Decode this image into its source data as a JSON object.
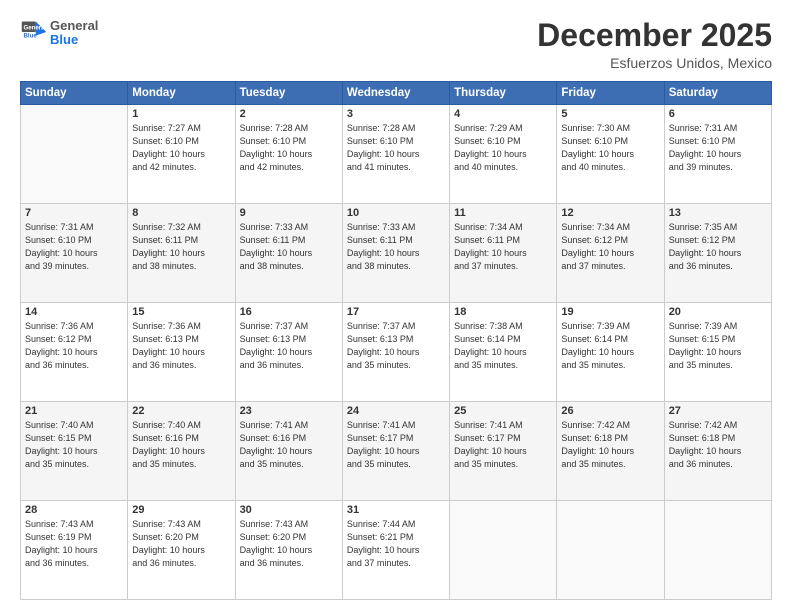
{
  "logo": {
    "general": "General",
    "blue": "Blue"
  },
  "header": {
    "month": "December 2025",
    "location": "Esfuerzos Unidos, Mexico"
  },
  "days_of_week": [
    "Sunday",
    "Monday",
    "Tuesday",
    "Wednesday",
    "Thursday",
    "Friday",
    "Saturday"
  ],
  "weeks": [
    [
      {
        "day": "",
        "info": ""
      },
      {
        "day": "1",
        "info": "Sunrise: 7:27 AM\nSunset: 6:10 PM\nDaylight: 10 hours\nand 42 minutes."
      },
      {
        "day": "2",
        "info": "Sunrise: 7:28 AM\nSunset: 6:10 PM\nDaylight: 10 hours\nand 42 minutes."
      },
      {
        "day": "3",
        "info": "Sunrise: 7:28 AM\nSunset: 6:10 PM\nDaylight: 10 hours\nand 41 minutes."
      },
      {
        "day": "4",
        "info": "Sunrise: 7:29 AM\nSunset: 6:10 PM\nDaylight: 10 hours\nand 40 minutes."
      },
      {
        "day": "5",
        "info": "Sunrise: 7:30 AM\nSunset: 6:10 PM\nDaylight: 10 hours\nand 40 minutes."
      },
      {
        "day": "6",
        "info": "Sunrise: 7:31 AM\nSunset: 6:10 PM\nDaylight: 10 hours\nand 39 minutes."
      }
    ],
    [
      {
        "day": "7",
        "info": "Sunrise: 7:31 AM\nSunset: 6:10 PM\nDaylight: 10 hours\nand 39 minutes."
      },
      {
        "day": "8",
        "info": "Sunrise: 7:32 AM\nSunset: 6:11 PM\nDaylight: 10 hours\nand 38 minutes."
      },
      {
        "day": "9",
        "info": "Sunrise: 7:33 AM\nSunset: 6:11 PM\nDaylight: 10 hours\nand 38 minutes."
      },
      {
        "day": "10",
        "info": "Sunrise: 7:33 AM\nSunset: 6:11 PM\nDaylight: 10 hours\nand 38 minutes."
      },
      {
        "day": "11",
        "info": "Sunrise: 7:34 AM\nSunset: 6:11 PM\nDaylight: 10 hours\nand 37 minutes."
      },
      {
        "day": "12",
        "info": "Sunrise: 7:34 AM\nSunset: 6:12 PM\nDaylight: 10 hours\nand 37 minutes."
      },
      {
        "day": "13",
        "info": "Sunrise: 7:35 AM\nSunset: 6:12 PM\nDaylight: 10 hours\nand 36 minutes."
      }
    ],
    [
      {
        "day": "14",
        "info": "Sunrise: 7:36 AM\nSunset: 6:12 PM\nDaylight: 10 hours\nand 36 minutes."
      },
      {
        "day": "15",
        "info": "Sunrise: 7:36 AM\nSunset: 6:13 PM\nDaylight: 10 hours\nand 36 minutes."
      },
      {
        "day": "16",
        "info": "Sunrise: 7:37 AM\nSunset: 6:13 PM\nDaylight: 10 hours\nand 36 minutes."
      },
      {
        "day": "17",
        "info": "Sunrise: 7:37 AM\nSunset: 6:13 PM\nDaylight: 10 hours\nand 35 minutes."
      },
      {
        "day": "18",
        "info": "Sunrise: 7:38 AM\nSunset: 6:14 PM\nDaylight: 10 hours\nand 35 minutes."
      },
      {
        "day": "19",
        "info": "Sunrise: 7:39 AM\nSunset: 6:14 PM\nDaylight: 10 hours\nand 35 minutes."
      },
      {
        "day": "20",
        "info": "Sunrise: 7:39 AM\nSunset: 6:15 PM\nDaylight: 10 hours\nand 35 minutes."
      }
    ],
    [
      {
        "day": "21",
        "info": "Sunrise: 7:40 AM\nSunset: 6:15 PM\nDaylight: 10 hours\nand 35 minutes."
      },
      {
        "day": "22",
        "info": "Sunrise: 7:40 AM\nSunset: 6:16 PM\nDaylight: 10 hours\nand 35 minutes."
      },
      {
        "day": "23",
        "info": "Sunrise: 7:41 AM\nSunset: 6:16 PM\nDaylight: 10 hours\nand 35 minutes."
      },
      {
        "day": "24",
        "info": "Sunrise: 7:41 AM\nSunset: 6:17 PM\nDaylight: 10 hours\nand 35 minutes."
      },
      {
        "day": "25",
        "info": "Sunrise: 7:41 AM\nSunset: 6:17 PM\nDaylight: 10 hours\nand 35 minutes."
      },
      {
        "day": "26",
        "info": "Sunrise: 7:42 AM\nSunset: 6:18 PM\nDaylight: 10 hours\nand 35 minutes."
      },
      {
        "day": "27",
        "info": "Sunrise: 7:42 AM\nSunset: 6:18 PM\nDaylight: 10 hours\nand 36 minutes."
      }
    ],
    [
      {
        "day": "28",
        "info": "Sunrise: 7:43 AM\nSunset: 6:19 PM\nDaylight: 10 hours\nand 36 minutes."
      },
      {
        "day": "29",
        "info": "Sunrise: 7:43 AM\nSunset: 6:20 PM\nDaylight: 10 hours\nand 36 minutes."
      },
      {
        "day": "30",
        "info": "Sunrise: 7:43 AM\nSunset: 6:20 PM\nDaylight: 10 hours\nand 36 minutes."
      },
      {
        "day": "31",
        "info": "Sunrise: 7:44 AM\nSunset: 6:21 PM\nDaylight: 10 hours\nand 37 minutes."
      },
      {
        "day": "",
        "info": ""
      },
      {
        "day": "",
        "info": ""
      },
      {
        "day": "",
        "info": ""
      }
    ]
  ]
}
